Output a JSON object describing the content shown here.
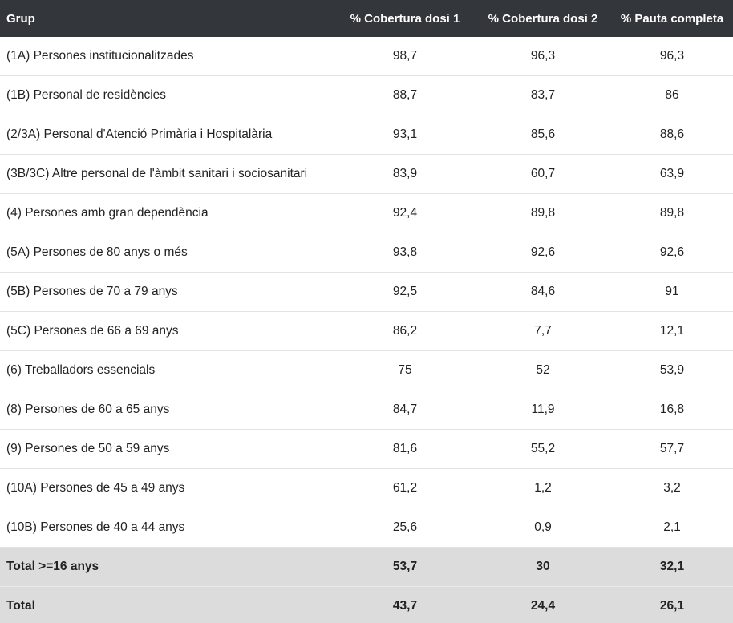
{
  "table": {
    "headers": [
      "Grup",
      "% Cobertura dosi 1",
      "% Cobertura dosi 2",
      "% Pauta completa"
    ],
    "rows": [
      [
        "(1A) Persones institucionalitzades",
        "98,7",
        "96,3",
        "96,3"
      ],
      [
        "(1B) Personal de residències",
        "88,7",
        "83,7",
        "86"
      ],
      [
        "(2/3A) Personal d'Atenció Primària i Hospitalària",
        "93,1",
        "85,6",
        "88,6"
      ],
      [
        "(3B/3C) Altre personal de l'àmbit sanitari i sociosanitari",
        "83,9",
        "60,7",
        "63,9"
      ],
      [
        "(4) Persones amb gran dependència",
        "92,4",
        "89,8",
        "89,8"
      ],
      [
        "(5A) Persones de 80 anys o més",
        "93,8",
        "92,6",
        "92,6"
      ],
      [
        "(5B) Persones de 70 a 79 anys",
        "92,5",
        "84,6",
        "91"
      ],
      [
        "(5C) Persones de 66 a 69 anys",
        "86,2",
        "7,7",
        "12,1"
      ],
      [
        "(6) Treballadors essencials",
        "75",
        "52",
        "53,9"
      ],
      [
        "(8) Persones de 60 a 65 anys",
        "84,7",
        "11,9",
        "16,8"
      ],
      [
        "(9) Persones de 50 a 59 anys",
        "81,6",
        "55,2",
        "57,7"
      ],
      [
        "(10A) Persones de 45 a 49 anys",
        "61,2",
        "1,2",
        "3,2"
      ],
      [
        "(10B) Persones de 40 a 44 anys",
        "25,6",
        "0,9",
        "2,1"
      ]
    ],
    "totals": [
      [
        "Total >=16 anys",
        "53,7",
        "30",
        "32,1"
      ],
      [
        "Total",
        "43,7",
        "24,4",
        "26,1"
      ]
    ]
  },
  "colors": {
    "header_bg": "#33363b",
    "header_text": "#ffffff",
    "total_bg": "#dcdcdc"
  }
}
